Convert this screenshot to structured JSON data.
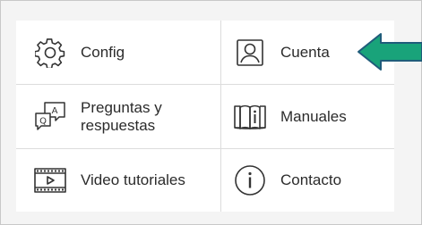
{
  "menu": {
    "items": [
      {
        "label": "Config",
        "icon": "gear-icon"
      },
      {
        "label": "Cuenta",
        "icon": "user-account-icon"
      },
      {
        "label": "Preguntas y respuestas",
        "icon": "qa-chat-icon"
      },
      {
        "label": "Manuales",
        "icon": "book-info-icon"
      },
      {
        "label": "Video tutoriales",
        "icon": "video-play-icon"
      },
      {
        "label": "Contacto",
        "icon": "info-circle-icon"
      }
    ]
  },
  "annotation": {
    "arrow_fill": "#19a37a",
    "arrow_stroke": "#1f5c7a",
    "points_to": "Cuenta"
  },
  "colors": {
    "text": "#2b2b2b",
    "icon_stroke": "#333333",
    "divider": "#dcdcdc",
    "background": "#f4f4f4"
  }
}
